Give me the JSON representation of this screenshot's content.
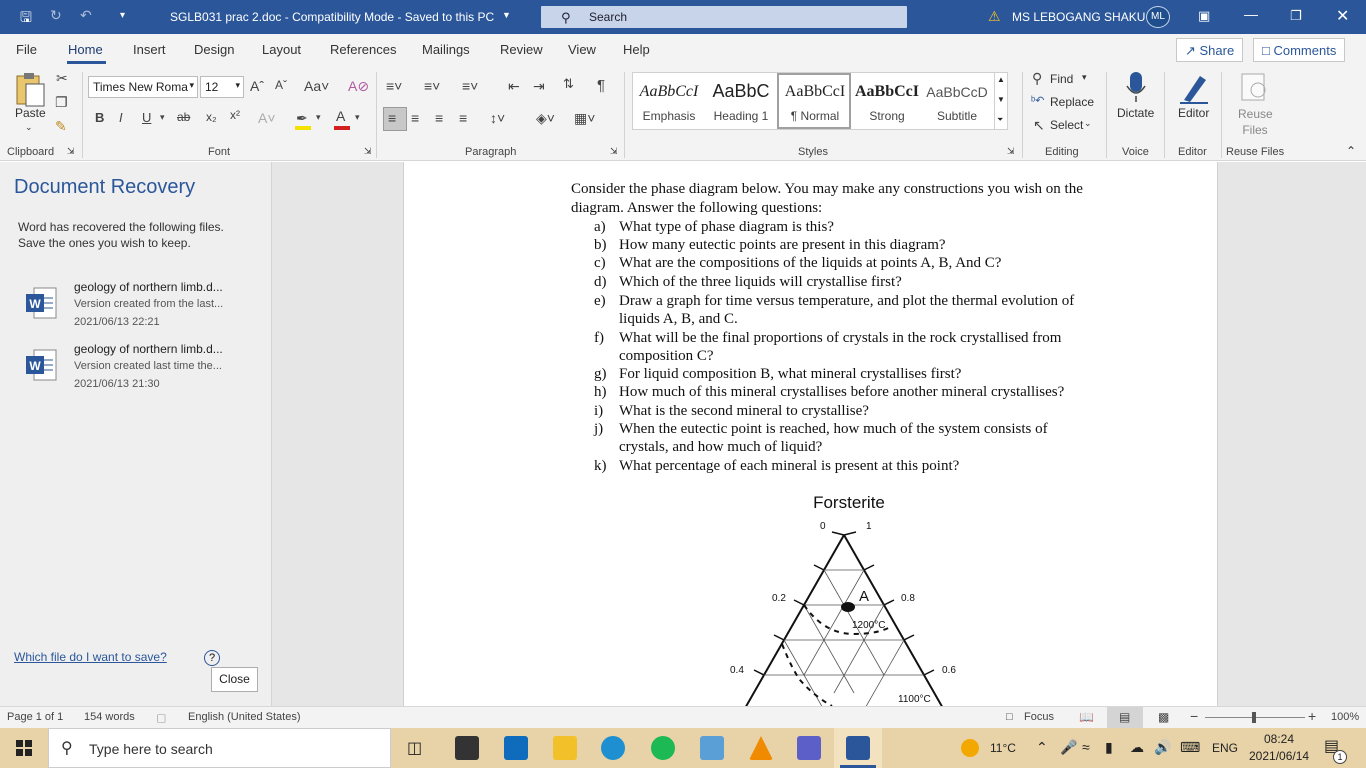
{
  "titlebar": {
    "doc_title": "SGLB031 prac 2.doc  -  Compatibility Mode  -  Saved to this PC",
    "search_placeholder": "Search",
    "user_name": "MS LEBOGANG SHAKU",
    "user_initials": "ML"
  },
  "tabs": [
    "File",
    "Home",
    "Insert",
    "Design",
    "Layout",
    "References",
    "Mailings",
    "Review",
    "View",
    "Help"
  ],
  "share_label": "Share",
  "comments_label": "Comments",
  "ribbon": {
    "paste_label": "Paste",
    "font_name": "Times New Roma",
    "font_size": "12",
    "groups": {
      "clipboard": "Clipboard",
      "font": "Font",
      "paragraph": "Paragraph",
      "styles": "Styles",
      "editing": "Editing",
      "voice": "Voice",
      "editor": "Editor",
      "reuse": "Reuse Files"
    },
    "styles": [
      {
        "preview": "AaBbCcI",
        "name": "Emphasis"
      },
      {
        "preview": "AaBbC",
        "name": "Heading 1"
      },
      {
        "preview": "AaBbCcI",
        "name": "¶ Normal"
      },
      {
        "preview": "AaBbCcI",
        "name": "Strong"
      },
      {
        "preview": "AaBbCcD",
        "name": "Subtitle"
      }
    ],
    "find_label": "Find",
    "replace_label": "Replace",
    "select_label": "Select",
    "dictate_label": "Dictate",
    "editor_label": "Editor",
    "reuse_label": "Reuse Files"
  },
  "recovery": {
    "title": "Document Recovery",
    "description": "Word has recovered the following files. Save the ones you wish to keep.",
    "files": [
      {
        "name": "geology of northern limb.d...",
        "version": "Version created from the last...",
        "date": "2021/06/13 22:21"
      },
      {
        "name": "geology of northern limb.d...",
        "version": "Version created last time the...",
        "date": "2021/06/13 21:30"
      }
    ],
    "help_link": "Which file do I want to save?",
    "close_label": "Close"
  },
  "document": {
    "intro": "Consider the phase diagram below. You may make any constructions you wish on the diagram. Answer the following questions:",
    "questions": [
      {
        "letter": "a)",
        "text": "What type of phase diagram is this?"
      },
      {
        "letter": "b)",
        "text": "How many eutectic points are present in this diagram?"
      },
      {
        "letter": "c)",
        "text": "What are the compositions of the liquids at points A, B, And C?"
      },
      {
        "letter": "d)",
        "text": "Which of the three liquids will crystallise first?"
      },
      {
        "letter": "e)",
        "text": "Draw a graph for time versus temperature, and plot the thermal evolution of liquids A, B, and C."
      },
      {
        "letter": "f)",
        "text": "What will be the final proportions of crystals in the rock crystallised from composition C?"
      },
      {
        "letter": "g)",
        "text": "For liquid composition B, what mineral crystallises first?"
      },
      {
        "letter": "h)",
        "text": "How much of this mineral crystallises before another mineral crystallises?"
      },
      {
        "letter": "i)",
        "text": "What is the second mineral to crystallise?"
      },
      {
        "letter": "j)",
        "text": "When the eutectic point is reached, how much of the system consists of crystals, and how much of liquid?"
      },
      {
        "letter": "k)",
        "text": "What percentage of each mineral is present at this point?"
      }
    ],
    "diagram": {
      "title": "Forsterite",
      "tick_0": "0",
      "tick_1": "1",
      "left_02": "0.2",
      "left_04": "0.4",
      "right_08": "0.8",
      "right_06": "0.6",
      "point_label": "A",
      "iso_1200": "1200°C",
      "iso_1100": "1100°C"
    }
  },
  "statusbar": {
    "page": "Page 1 of 1",
    "words": "154 words",
    "language": "English (United States)",
    "focus": "Focus",
    "zoom": "100%"
  },
  "taskbar": {
    "search_placeholder": "Type here to search",
    "weather": "11°C",
    "lang": "ENG",
    "time": "08:24",
    "date": "2021/06/14",
    "notifications": "1"
  }
}
